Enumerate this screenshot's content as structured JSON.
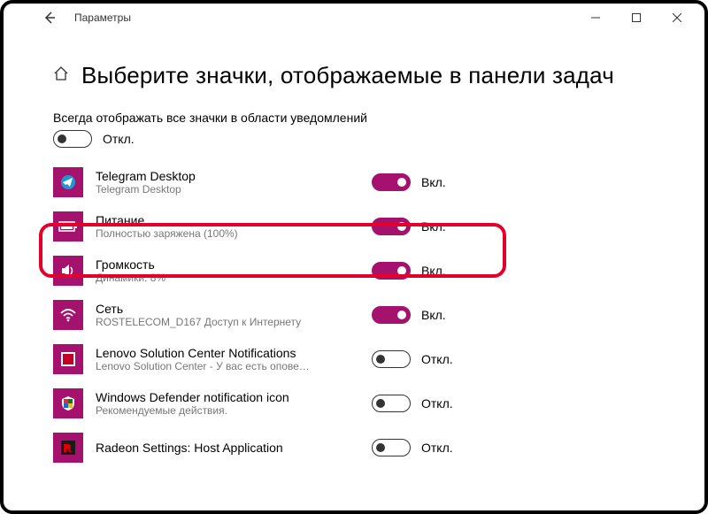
{
  "window": {
    "title": "Параметры"
  },
  "page": {
    "heading": "Выберите значки, отображаемые в панели задач",
    "always_show_label": "Всегда отображать все значки в области уведомлений",
    "always_show_state": "Откл.",
    "state_on": "Вкл.",
    "state_off": "Откл."
  },
  "items": [
    {
      "name": "Telegram Desktop",
      "sub": "Telegram Desktop",
      "on": true,
      "icon": "telegram"
    },
    {
      "name": "Питание",
      "sub": "Полностью заряжена (100%)",
      "on": true,
      "icon": "battery"
    },
    {
      "name": "Громкость",
      "sub": "Динамики: 8%",
      "on": true,
      "icon": "volume"
    },
    {
      "name": "Сеть",
      "sub": "ROSTELECOM_D167 Доступ к Интернету",
      "on": true,
      "icon": "wifi"
    },
    {
      "name": "Lenovo Solution Center Notifications",
      "sub": "Lenovo Solution Center - У вас есть опове…",
      "on": false,
      "icon": "lenovo"
    },
    {
      "name": "Windows Defender notification icon",
      "sub": "Рекомендуемые действия.",
      "on": false,
      "icon": "defender"
    },
    {
      "name": "Radeon Settings: Host Application",
      "sub": "",
      "on": false,
      "icon": "radeon"
    }
  ],
  "colors": {
    "accent": "#a4126e",
    "highlight": "#e3002b"
  }
}
